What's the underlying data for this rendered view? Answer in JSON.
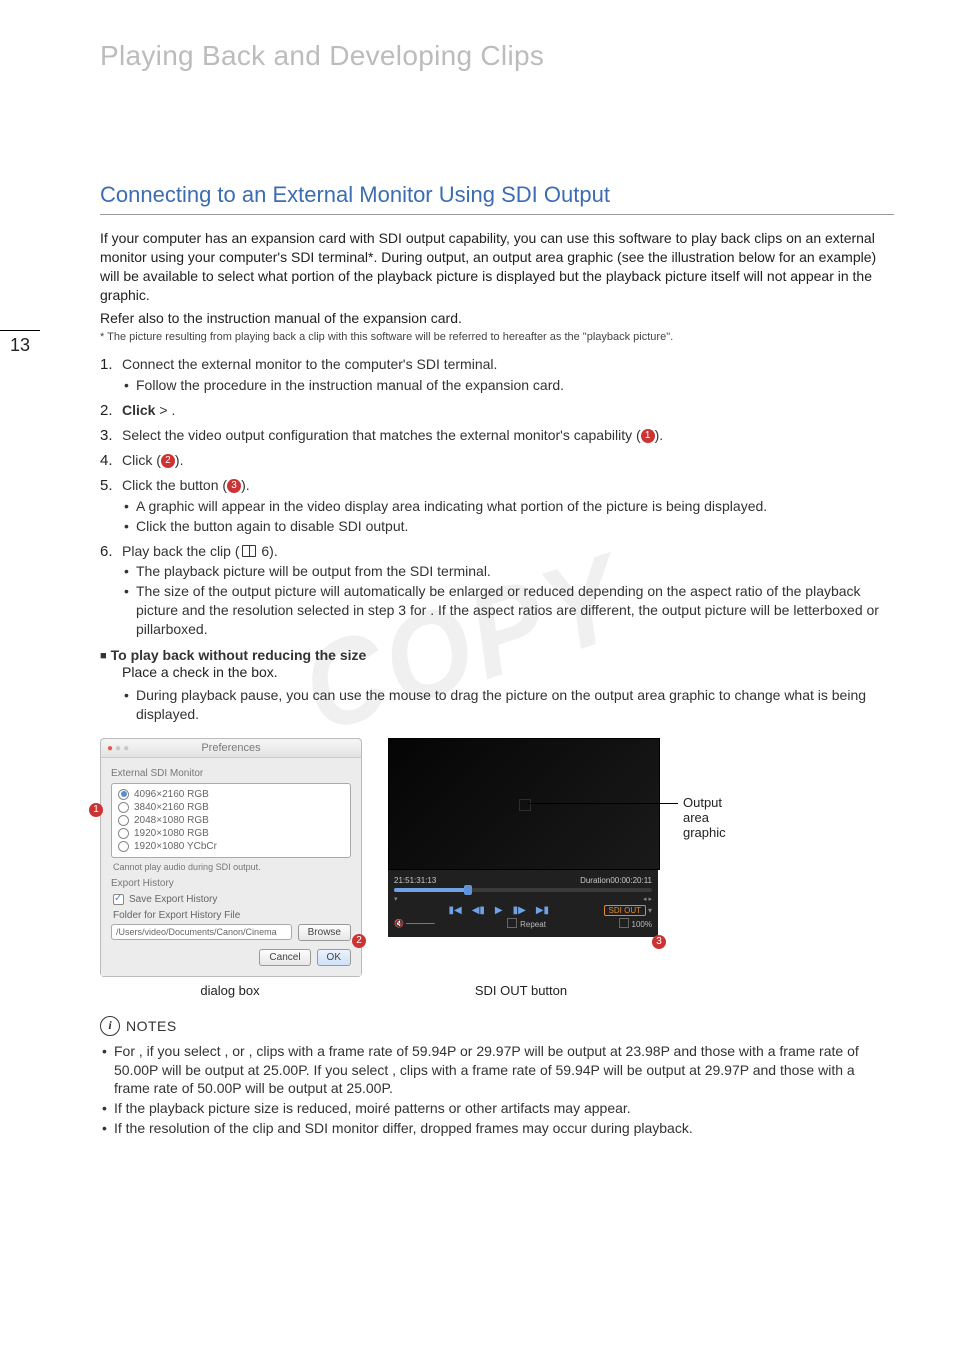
{
  "chapter_title": "Playing Back and Developing Clips",
  "page_number": "13",
  "section_title": "Connecting to an External Monitor Using SDI Output",
  "intro_p1": "If your computer has an expansion card with SDI output capability, you can use this software to play back clips on an external monitor using your computer's SDI terminal*. During output, an output area graphic (see the illustration below for an example) will be available to select what portion of the playback picture is displayed but the playback picture itself will not appear in the graphic.",
  "intro_p2": "Refer also to the instruction manual of the expansion card.",
  "footnote": "* The picture resulting from playing back a clip with this software will be referred to hereafter as the \"playback picture\".",
  "steps": {
    "s1": {
      "head": "Connect the external monitor to the computer's SDI terminal.",
      "sub1": "Follow the procedure in the instruction manual of the expansion card."
    },
    "s2": {
      "a": "Click ",
      "b": " > ",
      "c": "."
    },
    "s3": {
      "a": "Select the video output configuration that matches the external monitor's capability (",
      "b": ")."
    },
    "s4": {
      "a": "Click ",
      "b": " (",
      "c": ")."
    },
    "s5": {
      "a": "Click the ",
      "b": " button (",
      "c": ").",
      "sub1": "A graphic will appear in the video display area indicating what portion of the picture is being displayed.",
      "sub2a": "Click the ",
      "sub2b": " button again to disable SDI output."
    },
    "s6": {
      "a": "Play back the clip (",
      "b": " 6).",
      "sub1": "The playback picture will be output from the SDI terminal.",
      "sub2a": "The size of the output picture will automatically be enlarged or reduced depending on the aspect ratio of the playback picture and the resolution selected in step 3 for ",
      "sub2b": ". If the aspect ratios are different, the output picture will be letterboxed or pillarboxed."
    }
  },
  "sub_heading": "To play back without reducing the size",
  "sub_indent": {
    "a": "Place a check in the ",
    "b": " box.",
    "sub1": "During playback pause, you can use the mouse to drag the picture on the output area graphic to change what is being displayed."
  },
  "callouts": {
    "c1": "1",
    "c2": "2",
    "c3": "3"
  },
  "pref": {
    "title": "Preferences",
    "group1": "External SDI Monitor",
    "opts": [
      "4096×2160 RGB",
      "3840×2160 RGB",
      "2048×1080 RGB",
      "1920×1080 RGB",
      "1920×1080 YCbCr"
    ],
    "sel_index": 0,
    "warn": "Cannot play audio during SDI output.",
    "group2": "Export History",
    "save_history": "Save Export History",
    "folder_label": "Folder for Export History File",
    "folder_path": "/Users/video/Documents/Canon/Cinema",
    "browse": "Browse",
    "cancel": "Cancel",
    "ok": "OK"
  },
  "player": {
    "tc": "21:51:31:13",
    "dur_label": "Duration",
    "dur": "00:00:20:11",
    "sdi": "SDI OUT",
    "repeat": "Repeat",
    "zoom": "100%"
  },
  "anno_output_area": "Output area graphic",
  "fig_caption_left": "dialog box",
  "fig_caption_right": "SDI OUT button",
  "notes_label": "NOTES",
  "notes": {
    "n1a": "For ",
    "n1b": ", if you select ",
    "n1c": ", ",
    "n1d": " or ",
    "n1e": ", clips with a frame rate of 59.94P or 29.97P will be output at 23.98P and those with a frame rate of 50.00P will be output at 25.00P. If you select ",
    "n1f": ", clips with a frame rate of 59.94P will be output at 29.97P and those with a frame rate of 50.00P will be output at 25.00P.",
    "n2": "If the playback picture size is reduced, moiré patterns or other artifacts may appear.",
    "n3": "If the resolution of the clip and SDI monitor differ, dropped frames may occur during playback."
  },
  "watermark": "COPY"
}
